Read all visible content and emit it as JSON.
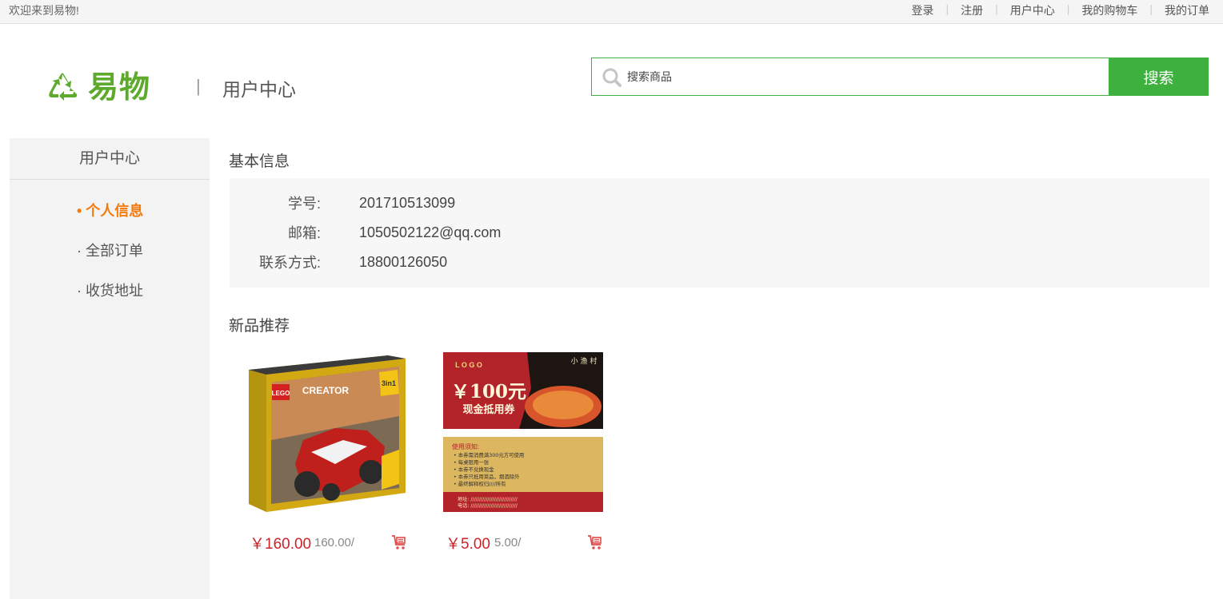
{
  "topbar": {
    "welcome": "欢迎来到易物!",
    "links": [
      "登录",
      "注册",
      "用户中心",
      "我的购物车",
      "我的订单"
    ]
  },
  "header": {
    "logo_text": "易物",
    "separator": "|",
    "page_title": "用户中心",
    "search_placeholder": "搜索商品",
    "search_button": "搜索",
    "brand_color": "#5daa2c",
    "accent_color": "#3db03d"
  },
  "sidebar": {
    "title": "用户中心",
    "items": [
      {
        "label": "• 个人信息",
        "active": true
      },
      {
        "label": "· 全部订单",
        "active": false
      },
      {
        "label": "· 收货地址",
        "active": false
      }
    ]
  },
  "basic_info": {
    "title": "基本信息",
    "fields": [
      {
        "label": "学号:",
        "value": "201710513099"
      },
      {
        "label": "邮箱:",
        "value": "1050502122@qq.com"
      },
      {
        "label": "联系方式:",
        "value": "18800126050"
      }
    ]
  },
  "new_products": {
    "title": "新品推荐",
    "items": [
      {
        "image_text": {
          "brand": "LEGO",
          "line": "CREATOR",
          "badge": "3in1"
        },
        "price": "￥160.00",
        "original": "160.00/",
        "cart_icon": "cart-icon"
      },
      {
        "image_text": {
          "logo": "L O G O",
          "amount": "￥100元",
          "subtitle": "现金抵用券",
          "shop": "小 渔 村",
          "notice_title": "使用须知:",
          "notice": [
            "• 本券需消费满300元方可使用",
            "• 每桌限用一张",
            "• 本券不兑换现金",
            "• 本券只抵用菜品，烟酒除外",
            "• 最终解释权归////所有"
          ],
          "footer": [
            "地址: ////////////////////////////",
            "电话: ////////////////////////////"
          ]
        },
        "price": "￥5.00",
        "original": "5.00/",
        "cart_icon": "cart-icon"
      }
    ]
  }
}
